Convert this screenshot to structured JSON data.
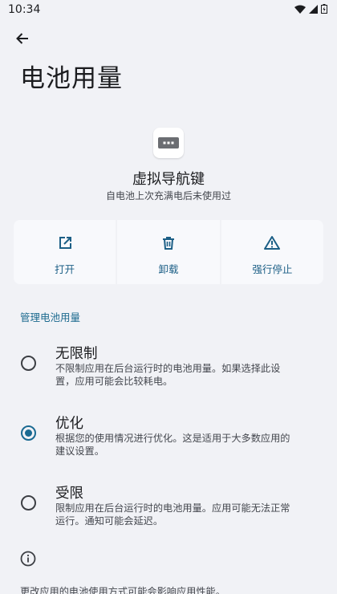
{
  "status_bar": {
    "time": "10:34"
  },
  "page": {
    "title": "电池用量"
  },
  "app": {
    "name": "虚拟导航键",
    "usage_summary": "自电池上次充满电后未使用过"
  },
  "actions": [
    {
      "label": "打开",
      "icon": "open-external-icon"
    },
    {
      "label": "卸载",
      "icon": "trash-icon"
    },
    {
      "label": "强行停止",
      "icon": "warning-icon"
    }
  ],
  "battery_section": {
    "header": "管理电池用量",
    "options": [
      {
        "title": "无限制",
        "description_line1": "不限制应用在后台运行时的电池用量。如果选择此设",
        "description_line2": "置，应用可能会比较耗电。",
        "selected": false
      },
      {
        "title": "优化",
        "description_line1": "根据您的使用情况进行优化。这是适用于大多数应用的",
        "description_line2": "建议设置。",
        "selected": true
      },
      {
        "title": "受限",
        "description_line1": "限制应用在后台运行时的电池用量。应用可能无法正常",
        "description_line2": "运行。通知可能会延迟。",
        "selected": false
      }
    ]
  },
  "footer": {
    "text": "更改应用的电池使用方式可能会影响应用性能。"
  },
  "colors": {
    "accent": "#1a6a92",
    "background": "#f1f2f6",
    "card": "#f8f9fc"
  }
}
